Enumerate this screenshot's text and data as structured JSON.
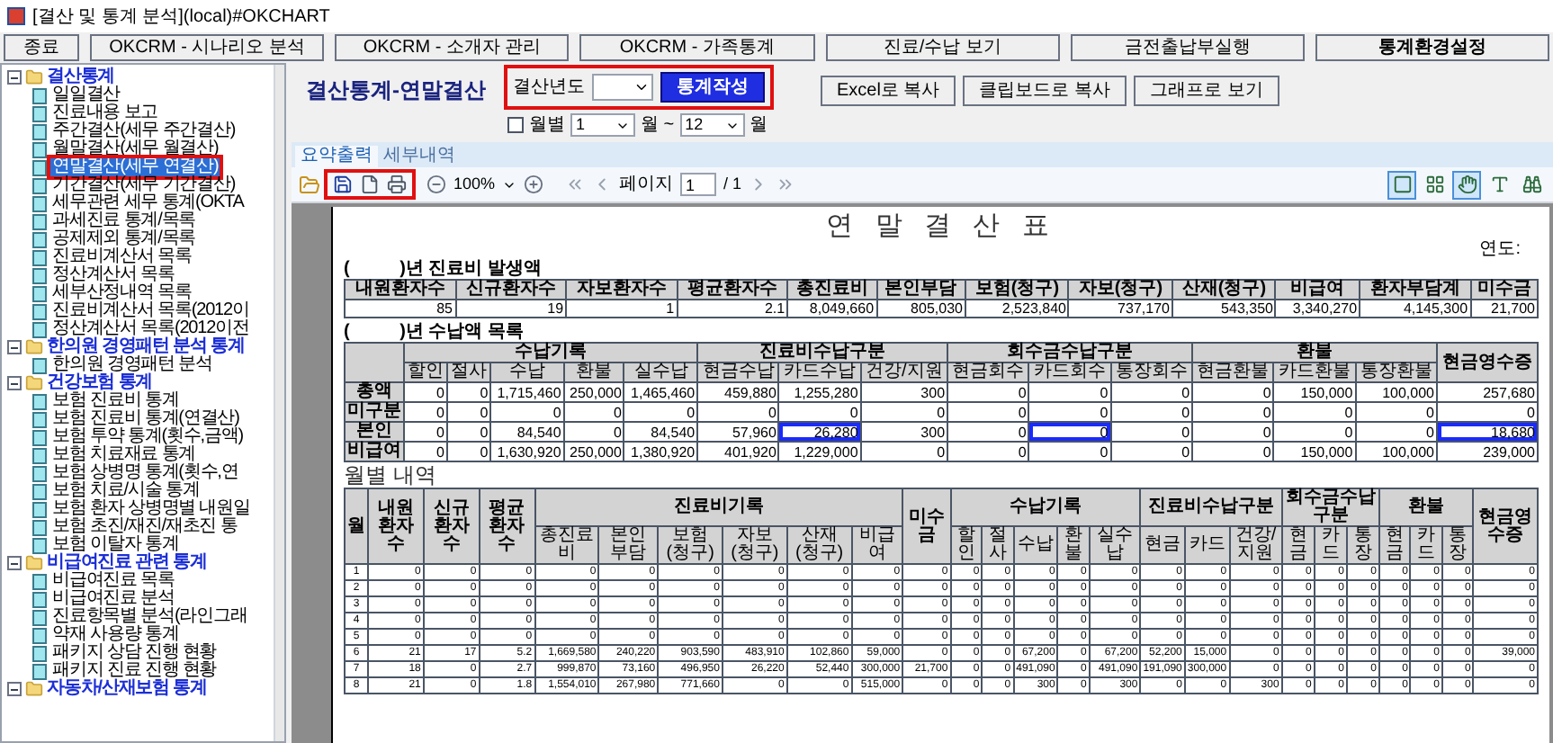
{
  "window": {
    "title": "[결산 및 통계 분석](local)#OKCHART"
  },
  "top_buttons": [
    {
      "label": "종료",
      "bold": false
    },
    {
      "label": "OKCRM - 시나리오 분석",
      "bold": false
    },
    {
      "label": "OKCRM - 소개자 관리",
      "bold": false
    },
    {
      "label": "OKCRM - 가족통계",
      "bold": false
    },
    {
      "label": "진료/수납 보기",
      "bold": false
    },
    {
      "label": "금전출납부실행",
      "bold": false
    },
    {
      "label": "통계환경설정",
      "bold": true
    }
  ],
  "tree": [
    {
      "label": "결산통계",
      "expanded": true,
      "children": [
        {
          "label": "일일결산",
          "selected": false,
          "marked": false
        },
        {
          "label": "진료내용 보고",
          "selected": false,
          "marked": false
        },
        {
          "label": "주간결산(세무 주간결산)",
          "selected": false,
          "marked": false
        },
        {
          "label": "월말결산(세무 월결산)",
          "selected": false,
          "marked": false
        },
        {
          "label": "연말결산(세무 연결산)",
          "selected": true,
          "marked": true
        },
        {
          "label": "기간결산(세무 기간결산)",
          "selected": false,
          "marked": false
        },
        {
          "label": "세무관련 세무 통계(OKTA",
          "selected": false,
          "marked": false
        },
        {
          "label": "과세진료 통계/목록",
          "selected": false,
          "marked": false
        },
        {
          "label": "공제제외 통계/목록",
          "selected": false,
          "marked": false
        },
        {
          "label": "진료비계산서 목록",
          "selected": false,
          "marked": false
        },
        {
          "label": "정산계산서 목록",
          "selected": false,
          "marked": false
        },
        {
          "label": "세부산정내역 목록",
          "selected": false,
          "marked": false
        },
        {
          "label": "진료비계산서 목록(2012이",
          "selected": false,
          "marked": false
        },
        {
          "label": "정산계산서 목록(2012이전",
          "selected": false,
          "marked": false
        }
      ]
    },
    {
      "label": "한의원 경영패턴 분석 통계",
      "expanded": true,
      "children": [
        {
          "label": "한의원 경영패턴 분석",
          "selected": false,
          "marked": false
        }
      ]
    },
    {
      "label": "건강보험 통계",
      "expanded": true,
      "children": [
        {
          "label": "보험 진료비 통계",
          "selected": false,
          "marked": false
        },
        {
          "label": "보험 진료비 통계(연결산)",
          "selected": false,
          "marked": false
        },
        {
          "label": "보험 투약 통계(횟수,금액)",
          "selected": false,
          "marked": false
        },
        {
          "label": "보험 치료재료 통계",
          "selected": false,
          "marked": false
        },
        {
          "label": "보험 상병명 통계(횟수,연",
          "selected": false,
          "marked": false
        },
        {
          "label": "보험 치료/시술 통계",
          "selected": false,
          "marked": false
        },
        {
          "label": "보험 환자 상병명별 내원일",
          "selected": false,
          "marked": false
        },
        {
          "label": "보험 초진/재진/재초진 통",
          "selected": false,
          "marked": false
        },
        {
          "label": "보험 이탈자 통계",
          "selected": false,
          "marked": false
        }
      ]
    },
    {
      "label": "비급여진료 관련 통계",
      "expanded": true,
      "children": [
        {
          "label": "비급여진료 목록",
          "selected": false,
          "marked": false
        },
        {
          "label": "비급여진료 분석",
          "selected": false,
          "marked": false
        },
        {
          "label": "진료항목별 분석(라인그래",
          "selected": false,
          "marked": false
        },
        {
          "label": "약재 사용량 통계",
          "selected": false,
          "marked": false
        },
        {
          "label": "패키지 상담 진행 현황",
          "selected": false,
          "marked": false
        },
        {
          "label": "패키지 진료 진행 현황",
          "selected": false,
          "marked": false
        }
      ]
    },
    {
      "label": "자동차/산재보험 통계",
      "expanded": true
    }
  ],
  "panel": {
    "title": "결산통계-연말결산",
    "year_label": "결산년도",
    "build_button": {
      "label": "통계작성",
      "marked": true
    },
    "actions": [
      "Excel로 복사",
      "클립보드로 복사",
      "그래프로 보기"
    ],
    "monthly": {
      "checked": false,
      "label": "월별",
      "from": "1",
      "from_unit": "월 ~",
      "to": "12",
      "to_unit": "월"
    }
  },
  "tabs": [
    {
      "label": "요약출력",
      "selected": true
    },
    {
      "label": "세부내역",
      "selected": false
    }
  ],
  "viewer_toolbar": {
    "file_group_marked": true,
    "zoom": "100%",
    "page_label": "페이지",
    "page": "1",
    "page_total": "/ 1",
    "tools": [
      {
        "kind": "single-page",
        "active": true
      },
      {
        "kind": "multi-page",
        "active": false
      },
      {
        "kind": "hand",
        "active": true
      },
      {
        "kind": "text",
        "active": false
      },
      {
        "kind": "find",
        "active": false
      }
    ]
  },
  "report": {
    "title": "연 말 결 산 표",
    "year_label": "연도:",
    "section1_label": "(          )년 진료비 발생액",
    "table1": {
      "columns": [
        "내원환자수",
        "신규환자수",
        "자보환자수",
        "평균환자수",
        "총진료비",
        "본인부담",
        "보험(청구)",
        "자보(청구)",
        "산재(청구)",
        "비급여",
        "환자부담계",
        "미수금"
      ],
      "values": [
        "85",
        "19",
        "1",
        "2.1",
        "8,049,660",
        "805,030",
        "2,523,840",
        "737,170",
        "543,350",
        "3,340,270",
        "4,145,300",
        "21,700"
      ]
    },
    "section2_label": "(          )년 수납액 목록",
    "table2": {
      "header": [
        {
          "label": "수납기록",
          "children": [
            "할인",
            "절사",
            "수납",
            "환불",
            "실수납"
          ]
        },
        {
          "label": "진료비수납구분",
          "children": [
            "현금수납",
            "카드수납",
            "건강/지원"
          ]
        },
        {
          "label": "회수금수납구분",
          "children": [
            "현금회수",
            "카드회수",
            "통장회수"
          ]
        },
        {
          "label": "환불",
          "children": [
            "현금환불",
            "카드환불",
            "통장환불"
          ]
        },
        {
          "label": "현금영수증"
        }
      ],
      "rows": [
        {
          "label": "총액",
          "cells": [
            {
              "text": "0",
              "boxed": false
            },
            {
              "text": "0",
              "boxed": false
            },
            {
              "text": "1,715,460",
              "boxed": false
            },
            {
              "text": "250,000",
              "boxed": false
            },
            {
              "text": "1,465,460",
              "boxed": false
            },
            {
              "text": "459,880",
              "boxed": false
            },
            {
              "text": "1,255,280",
              "boxed": false
            },
            {
              "text": "300",
              "boxed": false
            },
            {
              "text": "0",
              "boxed": false
            },
            {
              "text": "0",
              "boxed": false
            },
            {
              "text": "0",
              "boxed": false
            },
            {
              "text": "0",
              "boxed": false
            },
            {
              "text": "150,000",
              "boxed": false
            },
            {
              "text": "100,000",
              "boxed": false
            },
            {
              "text": "257,680",
              "boxed": false
            }
          ]
        },
        {
          "label": "미구분",
          "cells": [
            {
              "text": "0",
              "boxed": false
            },
            {
              "text": "0",
              "boxed": false
            },
            {
              "text": "0",
              "boxed": false
            },
            {
              "text": "0",
              "boxed": false
            },
            {
              "text": "0",
              "boxed": false
            },
            {
              "text": "0",
              "boxed": false
            },
            {
              "text": "0",
              "boxed": false
            },
            {
              "text": "0",
              "boxed": false
            },
            {
              "text": "0",
              "boxed": false
            },
            {
              "text": "0",
              "boxed": false
            },
            {
              "text": "0",
              "boxed": false
            },
            {
              "text": "0",
              "boxed": false
            },
            {
              "text": "0",
              "boxed": false
            },
            {
              "text": "0",
              "boxed": false
            },
            {
              "text": "0",
              "boxed": false
            }
          ]
        },
        {
          "label": "본인",
          "cells": [
            {
              "text": "0",
              "boxed": false
            },
            {
              "text": "0",
              "boxed": false
            },
            {
              "text": "84,540",
              "boxed": false
            },
            {
              "text": "0",
              "boxed": false
            },
            {
              "text": "84,540",
              "boxed": false
            },
            {
              "text": "57,960",
              "boxed": false
            },
            {
              "text": "26,280",
              "boxed": true
            },
            {
              "text": "300",
              "boxed": false
            },
            {
              "text": "0",
              "boxed": false
            },
            {
              "text": "0",
              "boxed": true
            },
            {
              "text": "0",
              "boxed": false
            },
            {
              "text": "0",
              "boxed": false
            },
            {
              "text": "0",
              "boxed": false
            },
            {
              "text": "0",
              "boxed": false
            },
            {
              "text": "18,680",
              "boxed": true
            }
          ]
        },
        {
          "label": "비급여",
          "cells": [
            {
              "text": "0",
              "boxed": false
            },
            {
              "text": "0",
              "boxed": false
            },
            {
              "text": "1,630,920",
              "boxed": false
            },
            {
              "text": "250,000",
              "boxed": false
            },
            {
              "text": "1,380,920",
              "boxed": false
            },
            {
              "text": "401,920",
              "boxed": false
            },
            {
              "text": "1,229,000",
              "boxed": false
            },
            {
              "text": "0",
              "boxed": false
            },
            {
              "text": "0",
              "boxed": false
            },
            {
              "text": "0",
              "boxed": false
            },
            {
              "text": "0",
              "boxed": false
            },
            {
              "text": "0",
              "boxed": false
            },
            {
              "text": "150,000",
              "boxed": false
            },
            {
              "text": "100,000",
              "boxed": false
            },
            {
              "text": "239,000",
              "boxed": false
            }
          ]
        }
      ]
    },
    "monthly_title": "월별 내역",
    "monthly": {
      "header": [
        {
          "label": "월"
        },
        {
          "label": "내원환자수"
        },
        {
          "label": "신규환자수"
        },
        {
          "label": "평균환자수"
        },
        {
          "label": "진료비기록",
          "children": [
            "총진료비",
            "본인부담",
            "보험(청구)",
            "자보(청구)",
            "산재(청구)",
            "비급여"
          ]
        },
        {
          "label": "미수금"
        },
        {
          "label": "수납기록",
          "children": [
            "할인",
            "절사",
            "수납",
            "환불",
            "실수납"
          ]
        },
        {
          "label": "진료비수납구분",
          "children": [
            "현금",
            "카드",
            "건강/지원"
          ]
        },
        {
          "label": "회수금수납구분",
          "children": [
            "현금",
            "카드",
            "통장"
          ]
        },
        {
          "label": "환불",
          "children": [
            "현금",
            "카드",
            "통장"
          ]
        },
        {
          "label": "현금영수증"
        }
      ],
      "rows": [
        [
          "1",
          "0",
          "0",
          "0",
          "0",
          "0",
          "0",
          "0",
          "0",
          "0",
          "0",
          "0",
          "0",
          "0",
          "0",
          "0",
          "0",
          "0",
          "0",
          "0",
          "0",
          "0",
          "0",
          "0",
          "0",
          "0"
        ],
        [
          "2",
          "0",
          "0",
          "0",
          "0",
          "0",
          "0",
          "0",
          "0",
          "0",
          "0",
          "0",
          "0",
          "0",
          "0",
          "0",
          "0",
          "0",
          "0",
          "0",
          "0",
          "0",
          "0",
          "0",
          "0",
          "0"
        ],
        [
          "3",
          "0",
          "0",
          "0",
          "0",
          "0",
          "0",
          "0",
          "0",
          "0",
          "0",
          "0",
          "0",
          "0",
          "0",
          "0",
          "0",
          "0",
          "0",
          "0",
          "0",
          "0",
          "0",
          "0",
          "0",
          "0"
        ],
        [
          "4",
          "0",
          "0",
          "0",
          "0",
          "0",
          "0",
          "0",
          "0",
          "0",
          "0",
          "0",
          "0",
          "0",
          "0",
          "0",
          "0",
          "0",
          "0",
          "0",
          "0",
          "0",
          "0",
          "0",
          "0",
          "0"
        ],
        [
          "5",
          "0",
          "0",
          "0",
          "0",
          "0",
          "0",
          "0",
          "0",
          "0",
          "0",
          "0",
          "0",
          "0",
          "0",
          "0",
          "0",
          "0",
          "0",
          "0",
          "0",
          "0",
          "0",
          "0",
          "0",
          "0"
        ],
        [
          "6",
          "21",
          "17",
          "5.2",
          "1,669,580",
          "240,220",
          "903,590",
          "483,910",
          "102,860",
          "59,000",
          "0",
          "0",
          "0",
          "67,200",
          "0",
          "67,200",
          "52,200",
          "15,000",
          "0",
          "0",
          "0",
          "0",
          "0",
          "0",
          "0",
          "39,000"
        ],
        [
          "7",
          "18",
          "0",
          "2.7",
          "999,870",
          "73,160",
          "496,950",
          "26,220",
          "52,440",
          "300,000",
          "21,700",
          "0",
          "0",
          "491,090",
          "0",
          "491,090",
          "191,090",
          "300,000",
          "0",
          "0",
          "0",
          "0",
          "0",
          "0",
          "0",
          "0"
        ],
        [
          "8",
          "21",
          "0",
          "1.8",
          "1,554,010",
          "267,980",
          "771,660",
          "0",
          "0",
          "515,000",
          "0",
          "0",
          "0",
          "300",
          "0",
          "300",
          "0",
          "0",
          "300",
          "0",
          "0",
          "0",
          "0",
          "0",
          "0",
          "0"
        ]
      ]
    }
  }
}
